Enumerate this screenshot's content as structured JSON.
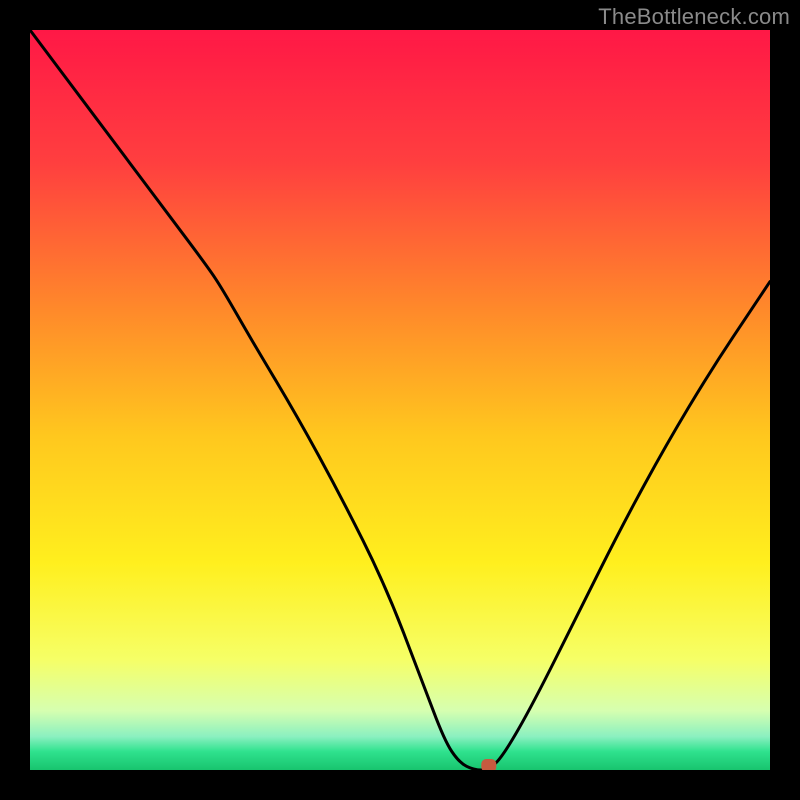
{
  "watermark": "TheBottleneck.com",
  "chart_data": {
    "type": "line",
    "title": "",
    "xlabel": "",
    "ylabel": "",
    "xlim": [
      0,
      100
    ],
    "ylim": [
      0,
      100
    ],
    "series": [
      {
        "name": "curve",
        "x": [
          0,
          6,
          12,
          18,
          24,
          26,
          30,
          36,
          42,
          48,
          53,
          56,
          58,
          60,
          62,
          64,
          68,
          74,
          80,
          86,
          92,
          98,
          100
        ],
        "y": [
          100,
          92,
          84,
          76,
          68,
          65,
          58,
          48,
          37,
          25,
          12,
          4,
          1,
          0,
          0,
          2,
          9,
          21,
          33,
          44,
          54,
          63,
          66
        ]
      }
    ],
    "marker": {
      "x": 62,
      "y": 0.6
    },
    "gradient_stops": [
      {
        "offset": 0.0,
        "color": "#ff1846"
      },
      {
        "offset": 0.18,
        "color": "#ff3f3f"
      },
      {
        "offset": 0.38,
        "color": "#ff8a2a"
      },
      {
        "offset": 0.55,
        "color": "#ffc81e"
      },
      {
        "offset": 0.72,
        "color": "#ffef1e"
      },
      {
        "offset": 0.85,
        "color": "#f6ff66"
      },
      {
        "offset": 0.92,
        "color": "#d6ffb0"
      },
      {
        "offset": 0.955,
        "color": "#8af0c0"
      },
      {
        "offset": 0.975,
        "color": "#2fe28e"
      },
      {
        "offset": 1.0,
        "color": "#18c46e"
      }
    ]
  }
}
